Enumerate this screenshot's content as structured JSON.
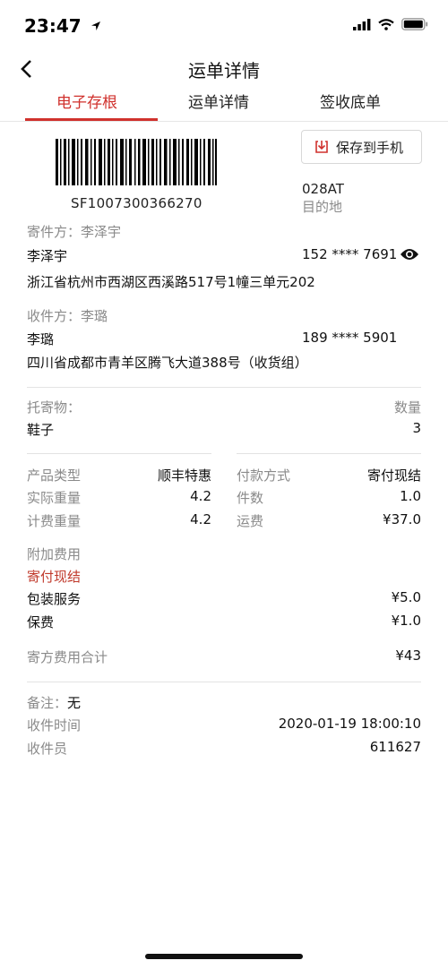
{
  "status": {
    "time": "23:47"
  },
  "nav": {
    "title": "运单详情"
  },
  "tabs": [
    "电子存根",
    "运单详情",
    "签收底单"
  ],
  "waybill": {
    "tracking_no": "SF1007300366270",
    "save_label": "保存到手机",
    "dest_code": "028AT",
    "dest_label": "目的地"
  },
  "sender": {
    "label": "寄件方：李泽宇",
    "name": "李泽宇",
    "phone": "152 **** 7691",
    "address": "浙江省杭州市西湖区西溪路517号1幢三单元202"
  },
  "receiver": {
    "label": "收件方：李璐",
    "name": "李璐",
    "phone": "189 **** 5901",
    "address": "四川省成都市青羊区腾飞大道388号（收货组）"
  },
  "goods": {
    "label": "托寄物：",
    "qty_label": "数量",
    "name": "鞋子",
    "qty": "3"
  },
  "details": {
    "product_type_label": "产品类型",
    "product_type": "顺丰特惠",
    "actual_weight_label": "实际重量",
    "actual_weight": "4.2",
    "billed_weight_label": "计费重量",
    "billed_weight": "4.2",
    "payment_label": "付款方式",
    "payment": "寄付现结",
    "pieces_label": "件数",
    "pieces": "1.0",
    "freight_label": "运费",
    "freight": "¥37.0"
  },
  "extra": {
    "label": "附加费用",
    "payment_mode": "寄付现结",
    "packing_label": "包装服务",
    "packing": "¥5.0",
    "insurance_label": "保费",
    "insurance": "¥1.0",
    "total_label": "寄方费用合计",
    "total": "¥43"
  },
  "footer": {
    "remark_label": "备注：",
    "remark": "无",
    "time_label": "收件时间",
    "time": "2020-01-19 18:00:10",
    "courier_label": "收件员",
    "courier": "611627"
  },
  "colors": {
    "accent": "#d0312d",
    "muted": "#8a8a8a"
  },
  "icons": [
    "location-arrow-icon",
    "signal-icon",
    "wifi-icon",
    "battery-icon",
    "back-chevron-icon",
    "download-icon",
    "eye-icon"
  ]
}
